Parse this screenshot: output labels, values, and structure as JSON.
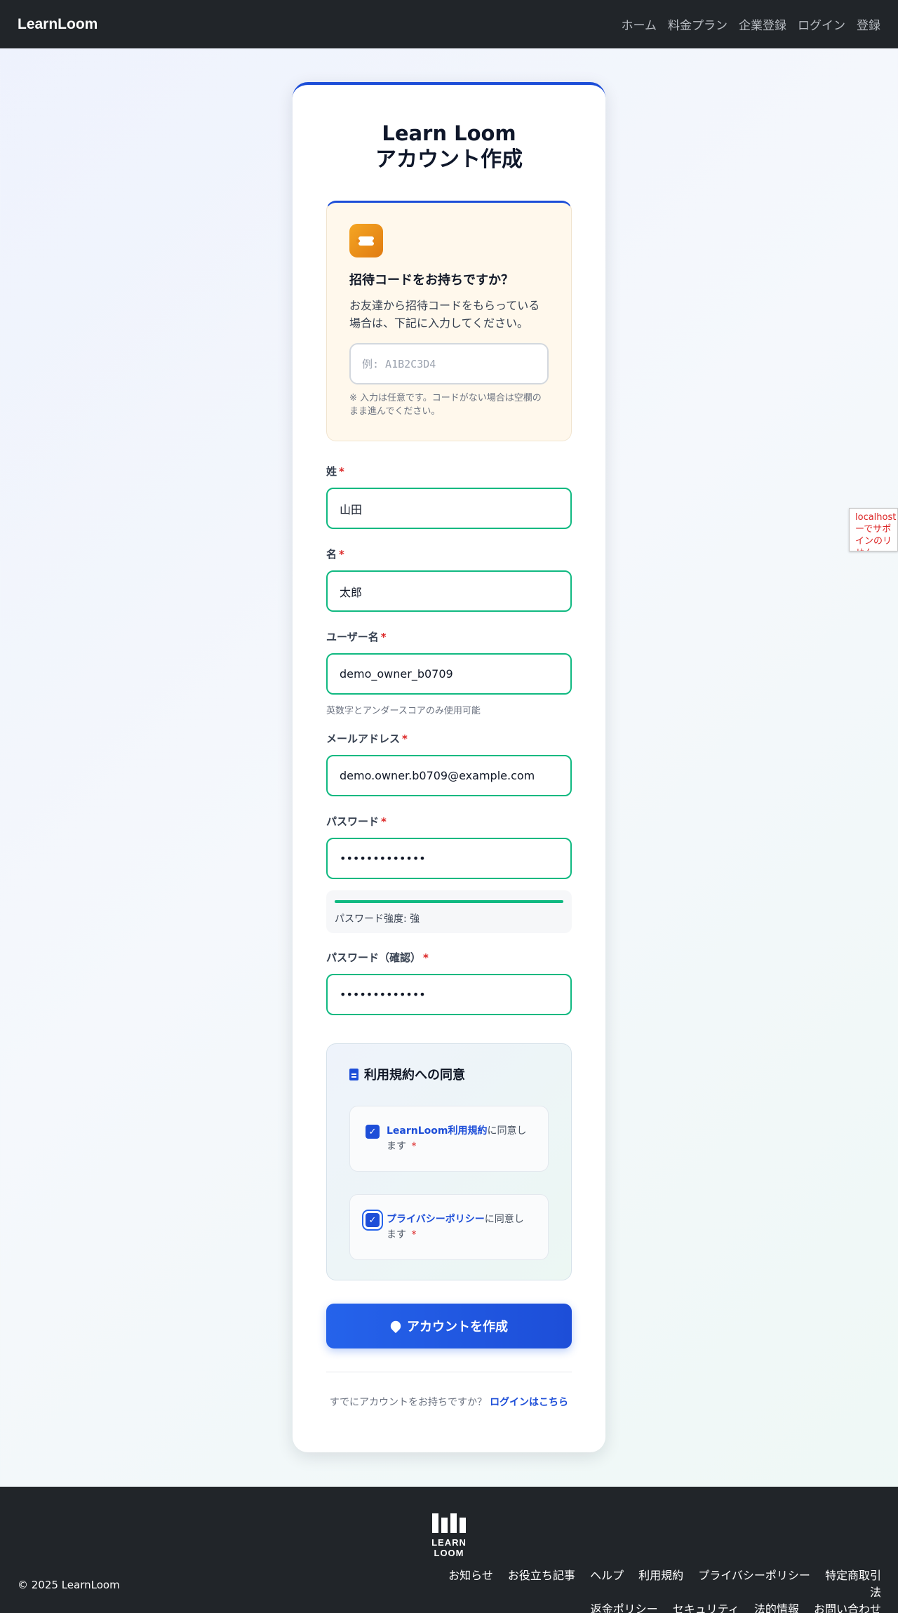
{
  "navbar": {
    "brand": "LearnLoom",
    "links": [
      "ホーム",
      "料金プラン",
      "企業登録",
      "ログイン",
      "登録"
    ]
  },
  "card": {
    "title_line1": "Learn Loom",
    "title_line2": "アカウント作成"
  },
  "invite": {
    "icon": "ticket-icon",
    "heading": "招待コードをお持ちですか？",
    "description": "お友達から招待コードをもらっている場合は、下記に入力してください。",
    "placeholder": "例: A1B2C3D4",
    "value": "",
    "note": "※ 入力は任意です。コードがない場合は空欄のまま進んでください。"
  },
  "form": {
    "required_mark": "*",
    "last_name": {
      "label": "姓",
      "value": "山田"
    },
    "first_name": {
      "label": "名",
      "value": "太郎"
    },
    "username": {
      "label": "ユーザー名",
      "value": "demo_owner_b0709",
      "hint": "英数字とアンダースコアのみ使用可能"
    },
    "email": {
      "label": "メールアドレス",
      "value": "demo.owner.b0709@example.com"
    },
    "password": {
      "label": "パスワード",
      "value": "•••••••••••••"
    },
    "password_strength": {
      "label": "パスワード強度: 強",
      "level": 1.0,
      "color": "#10b981"
    },
    "password_confirm": {
      "label": "パスワード（確認）",
      "value": "•••••••••••••"
    }
  },
  "terms": {
    "heading": "利用規約への同意",
    "items": [
      {
        "link": "LearnLoom利用規約",
        "suffix": "に同意します",
        "checked": true
      },
      {
        "link": "プライバシーポリシー",
        "suffix": "に同意します",
        "checked": true
      }
    ]
  },
  "submit_label": "アカウントを作成",
  "login_prompt": {
    "text": "すでにアカウントをお持ちですか？",
    "link": "ログインはこちら"
  },
  "side_tab_text": "localhost ーでサポ インのリ せん",
  "footer": {
    "logo_text": "LEARN LOOM",
    "copyright": "© 2025 LearnLoom",
    "links": [
      "お知らせ",
      "お役立ち記事",
      "ヘルプ",
      "利用規約",
      "プライバシーポリシー",
      "特定商取引法",
      "返金ポリシー",
      "セキュリティ",
      "法的情報",
      "お問い合わせ"
    ]
  },
  "colors": {
    "accent": "#1d4ed8",
    "success": "#10b981",
    "navbar": "#212529"
  }
}
